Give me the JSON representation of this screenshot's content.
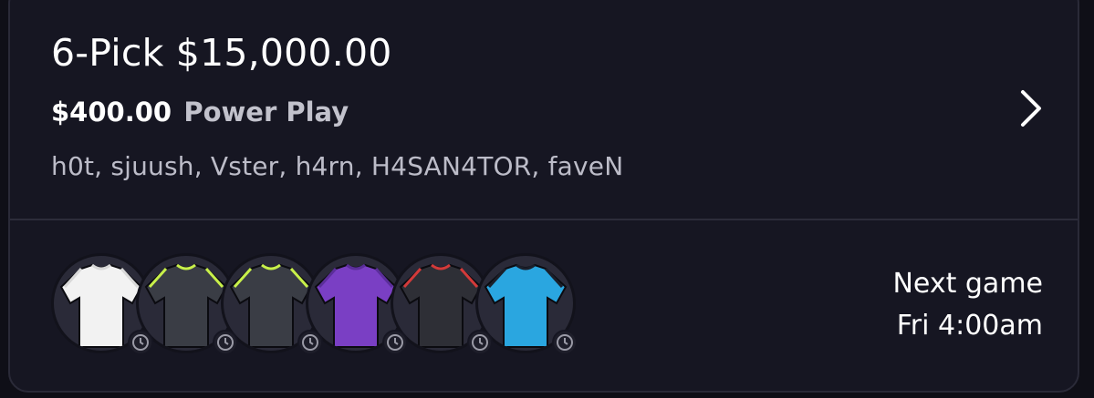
{
  "entry": {
    "title": "6-Pick $15,000.00",
    "stake": "$400.00",
    "play_type": "Power Play",
    "players": "h0t, sjuush, Vster, h4rn, H4SAN4TOR, faveN"
  },
  "jerseys": [
    {
      "icon": "white-jersey-icon",
      "body": "#f2f2f2",
      "trim": "#d8d8d8"
    },
    {
      "icon": "checkered-jersey-icon",
      "body": "#3a3d45",
      "trim": "#c8f04a"
    },
    {
      "icon": "checkered-jersey-icon",
      "body": "#3a3d45",
      "trim": "#c8f04a"
    },
    {
      "icon": "purple-jersey-icon",
      "body": "#7a3fc4",
      "trim": "#5b2e9a"
    },
    {
      "icon": "dark-jersey-icon",
      "body": "#2e2f36",
      "trim": "#d33a3a"
    },
    {
      "icon": "blue-gradient-jersey-icon",
      "body": "#2aa6e0",
      "trim": "#1b1f2a"
    }
  ],
  "next_game": {
    "label": "Next game",
    "time": "Fri 4:00am"
  },
  "colors": {
    "background": "#0f0f17",
    "card": "#161622",
    "secondary_text": "#bcbcc8"
  }
}
